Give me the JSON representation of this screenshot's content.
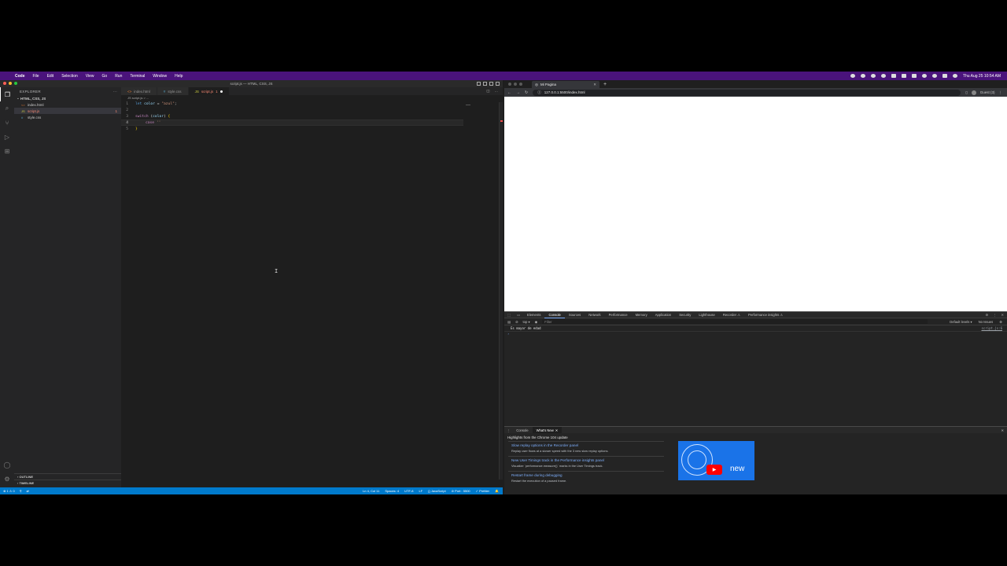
{
  "menubar": {
    "apple": "",
    "items": [
      "Code",
      "File",
      "Edit",
      "Selection",
      "View",
      "Go",
      "Run",
      "Terminal",
      "Window",
      "Help"
    ],
    "clock": "Thu Aug 25  10:54 AM"
  },
  "vscode": {
    "title": "script.js — HTML, CSS, JS",
    "sidebar": {
      "header": "EXPLORER",
      "folder": "HTML, CSS, JS",
      "files": [
        {
          "name": "index.html",
          "icon": "<>",
          "badge": ""
        },
        {
          "name": "script.js",
          "icon": "JS",
          "badge": "1"
        },
        {
          "name": "style.css",
          "icon": "#",
          "badge": ""
        }
      ],
      "outline": "OUTLINE",
      "timeline": "TIMELINE"
    },
    "tabs": [
      {
        "name": "index.html",
        "icon": "<>"
      },
      {
        "name": "style.css",
        "icon": "#"
      },
      {
        "name": "script.js",
        "icon": "JS",
        "suffix": "1"
      }
    ],
    "breadcrumb": "JS script.js > ...",
    "code": {
      "line1": {
        "n": "1",
        "kw": "let",
        "var": "color",
        "op": " = ",
        "str": "\"azul\"",
        "end": ";"
      },
      "line2": {
        "n": "2"
      },
      "line3": {
        "n": "3",
        "kw": "switch",
        "open": " (",
        "var": "color",
        "close": ") ",
        "brace": "{"
      },
      "line4": {
        "n": "4",
        "kw": "case",
        "str": "''"
      },
      "line5": {
        "n": "5",
        "brace": "}"
      }
    },
    "status": {
      "left": [
        "⊗ 1  ⚠ 0",
        "⚲",
        "⇄"
      ],
      "right": [
        "Ln 4, Col 11",
        "Spaces: 4",
        "UTF-8",
        "LF",
        "{} JavaScript",
        "⊘ Port : 5500",
        "✓ Prettier",
        "🔔"
      ]
    }
  },
  "chrome": {
    "tab_title": "Mi Pagina",
    "url": "127.0.0.1:5500/index.html",
    "profile": "Guest (3)",
    "devtools": {
      "tabs": [
        "Elements",
        "Console",
        "Sources",
        "Network",
        "Performance",
        "Memory",
        "Application",
        "Security",
        "Lighthouse",
        "Recorder ⚠",
        "Performance insights ⚠"
      ],
      "active_tab": "Console",
      "context": "top ▾",
      "filter_placeholder": "Filter",
      "levels": "Default levels ▾",
      "issues": "No Issues",
      "messages": [
        {
          "text": "Es mayor de edad",
          "source": "script.js:6"
        }
      ],
      "prompt": "›",
      "drawer_tabs": [
        "Console",
        "What's New"
      ],
      "whats_new_title": "Highlights from the Chrome 104 update",
      "news": [
        {
          "title": "Slow replay options in the Recorder panel",
          "desc": "Replay user flows at a slower speed with the 3 new slow replay options."
        },
        {
          "title": "New User Timings track in the Performance insights panel",
          "desc": "Visualize `performance.measure()` marks in the User Timings track."
        },
        {
          "title": "Restart frame during debugging",
          "desc": "Restart the execution of a paused frame."
        }
      ],
      "video_label": "new"
    }
  }
}
